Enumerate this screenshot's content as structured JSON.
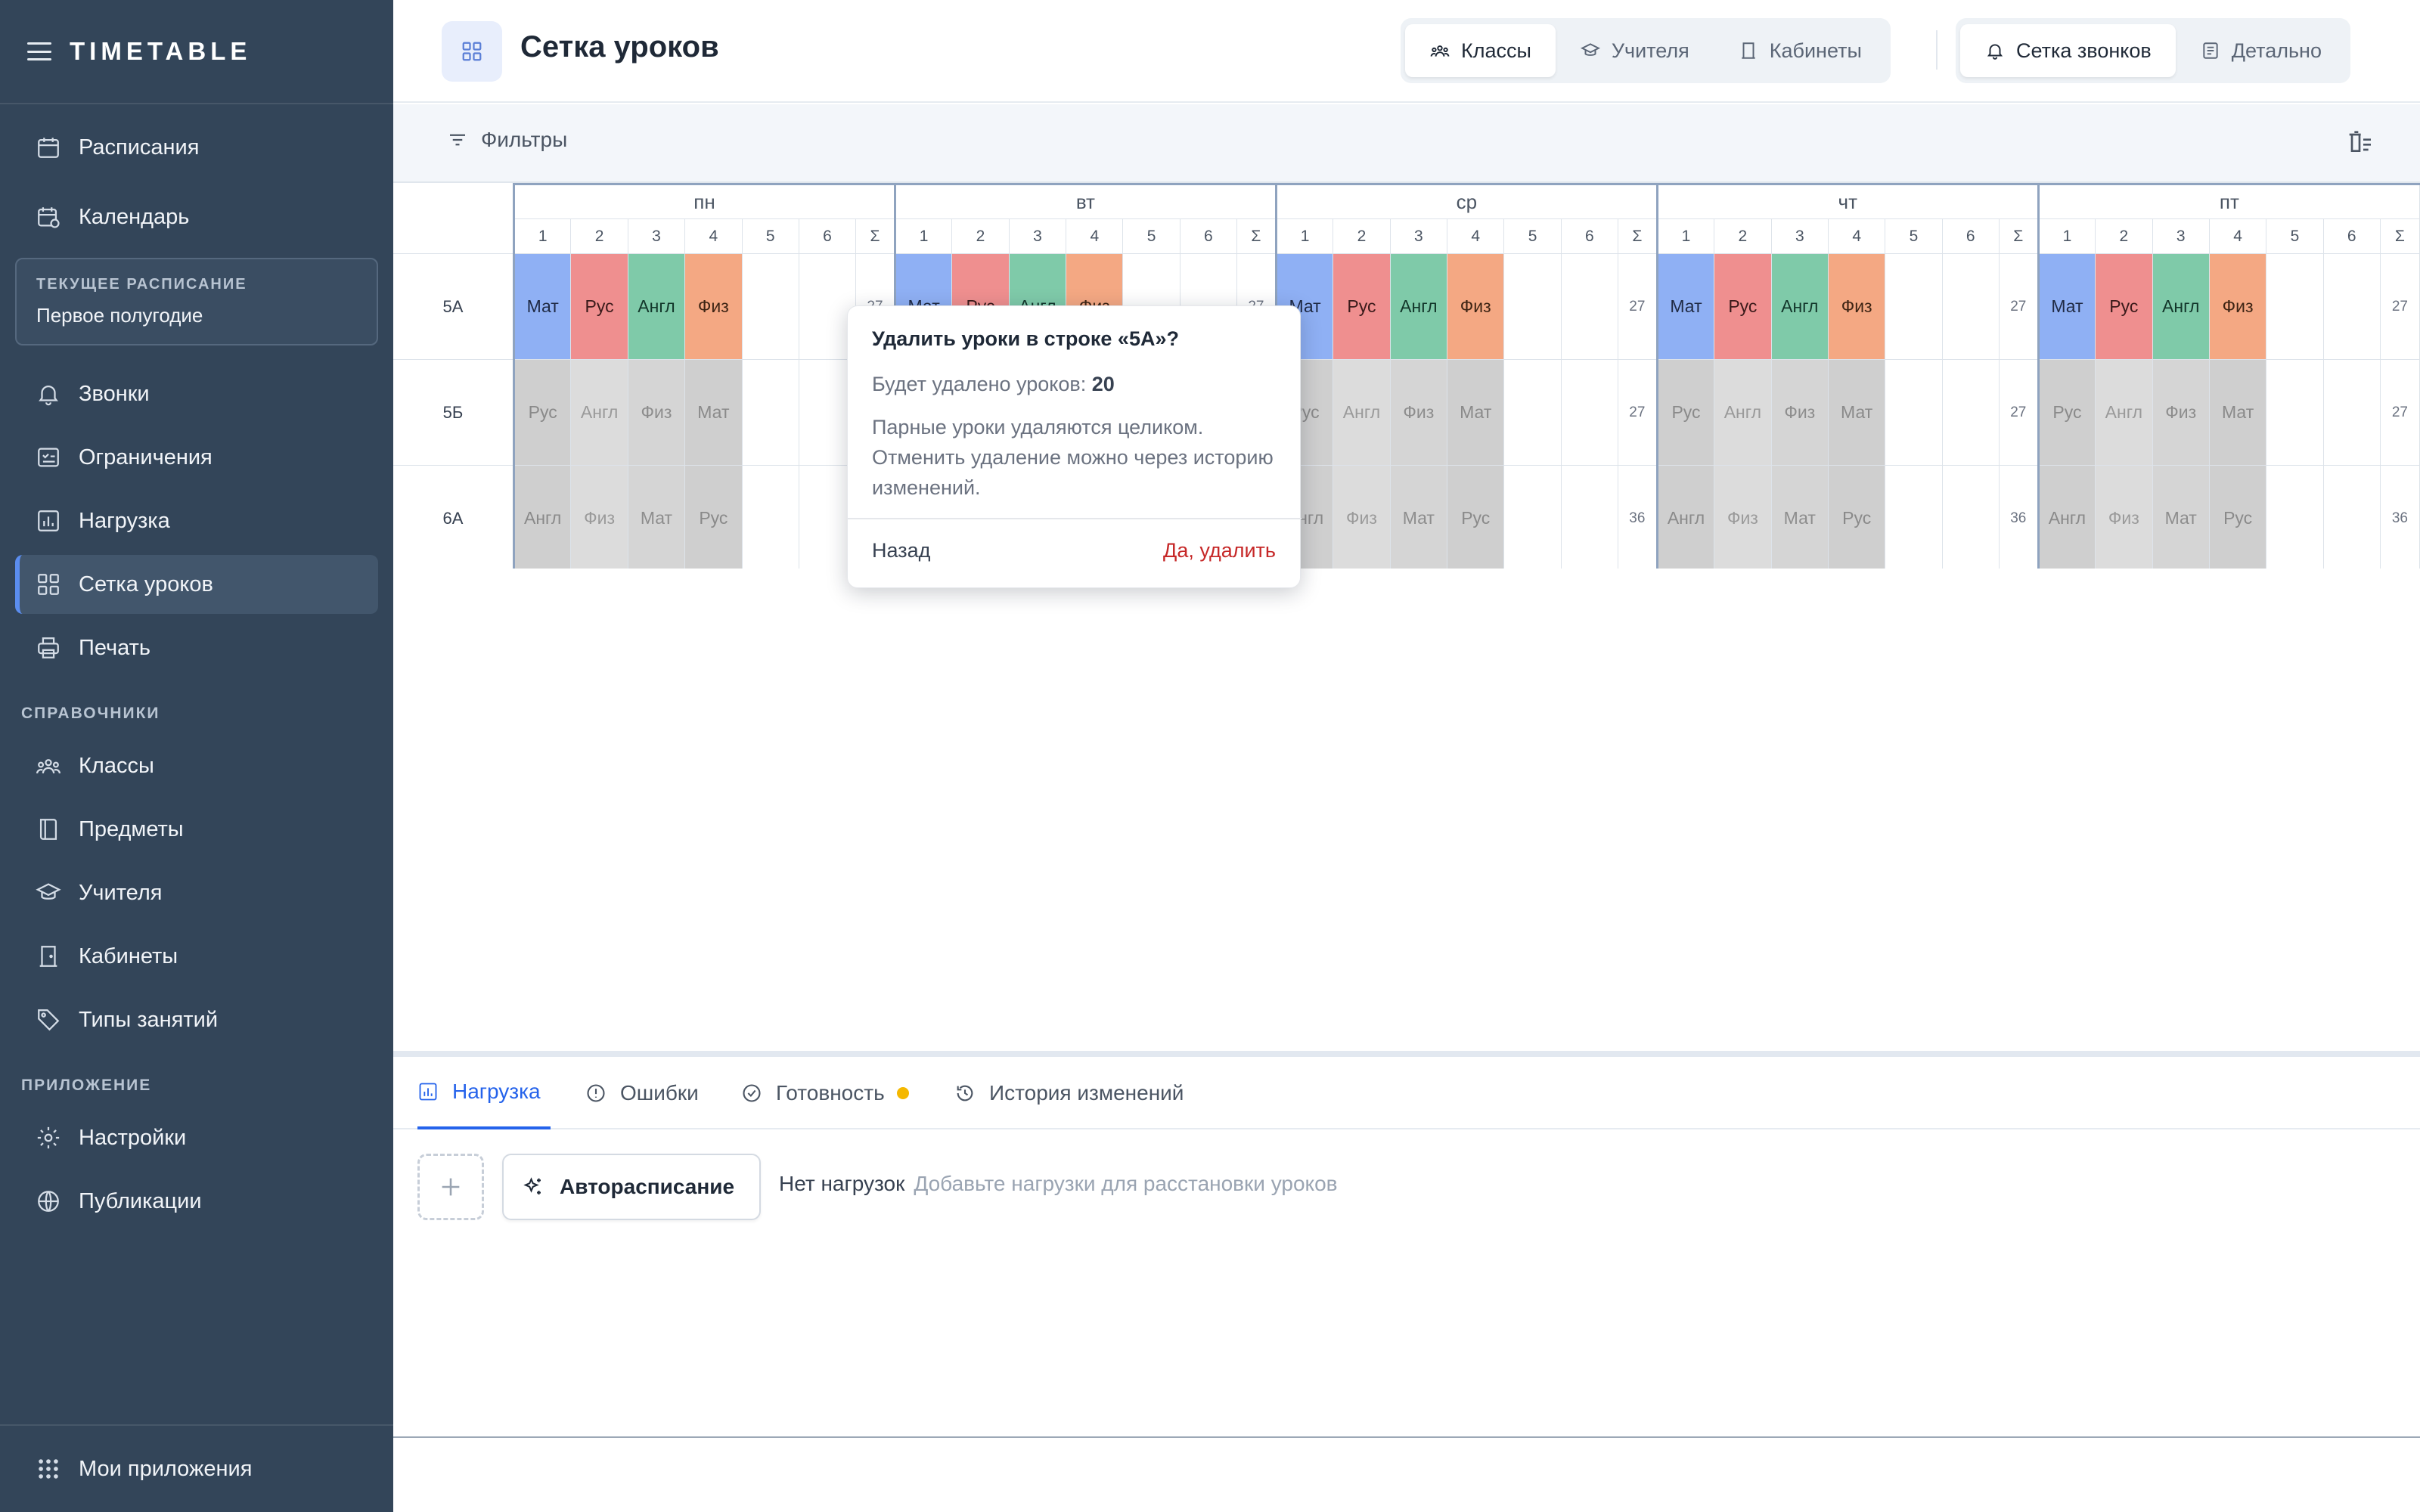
{
  "app": {
    "brand": "TIMETABLE"
  },
  "sidebar": {
    "items_top": [
      {
        "label": "Расписания",
        "icon": "calendar-icon"
      },
      {
        "label": "Календарь",
        "icon": "calendar-clock-icon"
      }
    ],
    "current": {
      "label": "ТЕКУЩЕЕ РАСПИСАНИЕ",
      "value": "Первое полугодие"
    },
    "items_main": [
      {
        "label": "Звонки",
        "icon": "bell-icon"
      },
      {
        "label": "Ограничения",
        "icon": "checklist-icon"
      },
      {
        "label": "Нагрузка",
        "icon": "bar-chart-icon"
      },
      {
        "label": "Сетка уроков",
        "icon": "grid-icon",
        "active": true
      },
      {
        "label": "Печать",
        "icon": "printer-icon"
      }
    ],
    "section_refs": "СПРАВОЧНИКИ",
    "items_refs": [
      {
        "label": "Классы",
        "icon": "users-icon"
      },
      {
        "label": "Предметы",
        "icon": "book-icon"
      },
      {
        "label": "Учителя",
        "icon": "graduation-cap-icon"
      },
      {
        "label": "Кабинеты",
        "icon": "door-icon"
      },
      {
        "label": "Типы занятий",
        "icon": "tag-icon"
      }
    ],
    "section_app": "ПРИЛОЖЕНИЕ",
    "items_app": [
      {
        "label": "Настройки",
        "icon": "gear-icon"
      },
      {
        "label": "Публикации",
        "icon": "globe-icon"
      }
    ],
    "bottom": {
      "label": "Мои приложения",
      "icon": "apps-grid-icon"
    }
  },
  "header": {
    "title": "Сетка уроков",
    "views": [
      {
        "label": "Классы",
        "icon": "users-icon",
        "active": true
      },
      {
        "label": "Учителя",
        "icon": "graduation-cap-icon",
        "active": false
      },
      {
        "label": "Кабинеты",
        "icon": "door-icon",
        "active": false
      }
    ],
    "modes": [
      {
        "label": "Сетка звонков",
        "icon": "bell-icon",
        "active": true
      },
      {
        "label": "Детально",
        "icon": "list-icon",
        "active": false
      }
    ]
  },
  "filters": {
    "label": "Фильтры"
  },
  "grid": {
    "days": [
      "пн",
      "вт",
      "ср",
      "чт",
      "пт"
    ],
    "periods": [
      "1",
      "2",
      "3",
      "4",
      "5",
      "6",
      "Σ"
    ],
    "rows": [
      {
        "label": "5А",
        "lessons": [
          "Мат",
          "Рус",
          "Англ",
          "Физ"
        ],
        "sum": "27",
        "style": "color"
      },
      {
        "label": "5Б",
        "lessons": [
          "Рус",
          "Англ",
          "Физ",
          "Мат"
        ],
        "sum": "27",
        "style": "gray"
      },
      {
        "label": "6А",
        "lessons": [
          "Англ",
          "Физ",
          "Мат",
          "Рус"
        ],
        "sum": "36",
        "style": "gray"
      }
    ]
  },
  "popover": {
    "title": "Удалить уроки в строке «5А»?",
    "count_label": "Будет удалено уроков:",
    "count_value": "20",
    "note": "Парные уроки удаляются целиком. Отменить удаление можно через историю изменений.",
    "cancel": "Назад",
    "confirm": "Да, удалить"
  },
  "bottom_panel": {
    "tabs": [
      {
        "label": "Нагрузка",
        "icon": "bar-chart-icon",
        "active": true
      },
      {
        "label": "Ошибки",
        "icon": "alert-circle-icon",
        "active": false
      },
      {
        "label": "Готовность",
        "icon": "check-circle-icon",
        "active": false,
        "dot": true
      },
      {
        "label": "История изменений",
        "icon": "history-icon",
        "active": false
      }
    ],
    "auto_button": "Авторасписание",
    "empty_title": "Нет нагрузок",
    "empty_hint": "Добавьте нагрузки для расстановки уроков",
    "colors": {
      "accent": "#2563eb",
      "dot": "#f5b800"
    }
  }
}
